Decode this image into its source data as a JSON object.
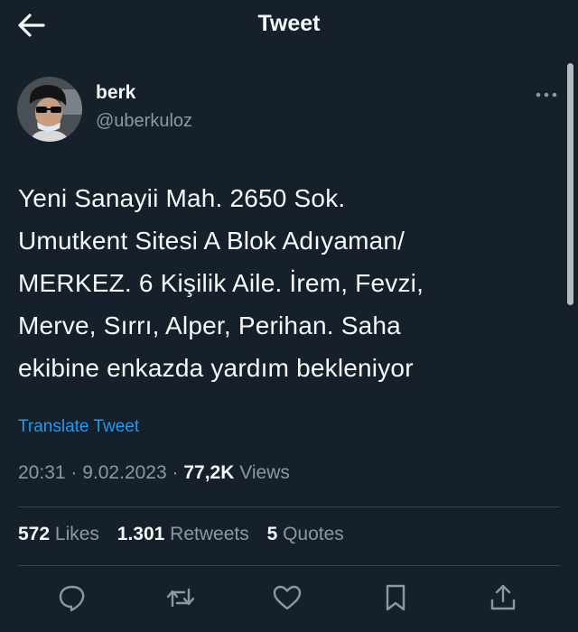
{
  "header": {
    "title": "Tweet",
    "back_icon": "arrow-left-icon"
  },
  "author": {
    "name": "berk",
    "handle": "@uberkuloz"
  },
  "tweet": {
    "lines": [
      "Yeni Sanayii Mah. 2650 Sok.",
      "Umutkent Sitesi A Blok Adıyaman/",
      "MERKEZ. 6 Kişilik Aile. İrem, Fevzi,",
      "Merve, Sırrı, Alper, Perihan. Saha",
      "ekibine enkazda yardım bekleniyor"
    ],
    "translate_label": "Translate Tweet"
  },
  "meta": {
    "time": "20:31",
    "sep1": " · ",
    "date": "9.02.2023",
    "sep2": " · ",
    "views_count": "77,2K",
    "views_label": " Views"
  },
  "stats": {
    "likes_count": "572",
    "likes_label": "Likes",
    "retweets_count": "1.301",
    "retweets_label": "Retweets",
    "quotes_count": "5",
    "quotes_label": "Quotes"
  },
  "actions": [
    "reply-icon",
    "retweet-icon",
    "like-icon",
    "bookmark-icon",
    "share-icon"
  ],
  "colors": {
    "background": "#15202b",
    "text": "#f7f9f9",
    "muted": "#8b98a5",
    "accent": "#1d9bf0",
    "divider": "#38444d"
  }
}
